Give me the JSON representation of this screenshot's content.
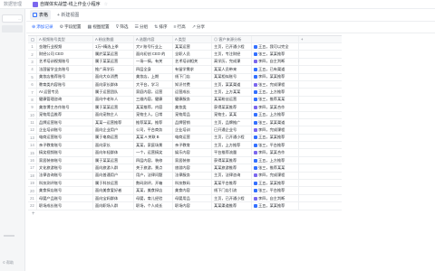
{
  "topbar": {
    "crumb": "数据管理",
    "doc_title": "自媒体实战营-线上作业小程序",
    "star": "☆"
  },
  "sidebar": {
    "active_label": "...",
    "bottom_label": "© 帮助"
  },
  "tabs": [
    {
      "label": "表格",
      "active": true
    },
    {
      "label": "+ 新建视图",
      "active": false
    }
  ],
  "toolbar": {
    "add_record": "添加记录",
    "field_config": "字段配置",
    "view_config": "视图配置",
    "filter": "筛选",
    "group": "分组",
    "sort": "排序",
    "row_height": "行高",
    "share": "分享"
  },
  "table": {
    "columns": [
      "A 视频账号类型",
      "A 粉丝数据",
      "A 选题内容",
      "A 类型",
      "◎ 客户来源分析"
    ],
    "rows": [
      {
        "c1": "金融行业视频",
        "c2": "1万+精选上季",
        "c3": "大V 账号行业上",
        "c4": "某某运营",
        "c5": "主页，已开通小程"
      },
      {
        "c1": "财经公司 CEO",
        "c2": "属於某某运营",
        "c3": "面向初创 CEO 的",
        "c4": "全职人员",
        "c5": "主页，专注财经"
      },
      {
        "c1": "艺术培训视频账号",
        "c2": "属于某某运营",
        "c3": "一场一搞，有关",
        "c4": "艺术培训相关",
        "c5": "高学历，完成课"
      },
      {
        "c1": "法国留学业务账号",
        "c2": "推广高学历",
        "c3": "四层全身",
        "c4": "有留学需求",
        "c5": "某某人员带来"
      },
      {
        "c1": "美妆店推荐账号",
        "c2": "面向大众消费",
        "c3": "美妆店，上期",
        "c4": "线下门店",
        "c5": "某某相似账号"
      },
      {
        "c1": "教育类内容账号",
        "c2": "面向家长群体",
        "c3": "大平台，学习",
        "c4": "知识付费",
        "c5": "主页，某某渠道"
      },
      {
        "c1": "AI 运营专员",
        "c2": "属于运营团队",
        "c3": "家庭内容，运营",
        "c4": "运营成长",
        "c5": "主页，上方某某"
      },
      {
        "c1": "健康管理咨询",
        "c2": "面向中老年人",
        "c3": "三维内容，健康",
        "c4": "健康服务",
        "c5": "某某粉丝运营"
      },
      {
        "c1": "美妆博主合作账号",
        "c2": "属于某某运营",
        "c3": "某某推荐，内容",
        "c4": "美妆类",
        "c5": "获得某某推荐"
      },
      {
        "c1": "宠物用品推荐",
        "c2": "面向宠物主人",
        "c3": "宠物主人，日常",
        "c4": "宠物用品",
        "c5": "宠物主，某某"
      },
      {
        "c1": "品牌运营账号",
        "c2": "某某一运营推荐",
        "c3": "推荐某某，推荐",
        "c4": "品牌营销",
        "c5": "主页，品牌推广"
      },
      {
        "c1": "企业培训账号",
        "c2": "面向企业用户",
        "c3": "公司，平台商务",
        "c4": "企业培训",
        "c5": "已开通企业号"
      },
      {
        "c1": "电商运营账号",
        "c2": "属于电商运营",
        "c3": "某某 A 关联 B",
        "c4": "电商运营",
        "c5": "主页，已开通小程"
      },
      {
        "c1": "亲子教育账号",
        "c2": "面向家长",
        "c3": "某某，家庭场景",
        "c4": "亲子教育",
        "c5": "主页，上方推荐"
      },
      {
        "c1": "搞笑视频账号",
        "c2": "面向年轻群体",
        "c3": "一个，运营搞笑",
        "c4": "娱乐内容",
        "c5": "平台推荐流量"
      },
      {
        "c1": "家居装修账号",
        "c2": "属于某某运营",
        "c3": "四层内容，装修",
        "c4": "家居装修",
        "c5": "获得某某推荐"
      },
      {
        "c1": "文化旅游账号",
        "c2": "面向旅游人群",
        "c3": "关于旅游，景点",
        "c4": "旅游内容",
        "c5": "某某旅游推荐"
      },
      {
        "c1": "法律咨询账号",
        "c2": "面向普通用户",
        "c3": "用户，法律问题",
        "c4": "法律服务",
        "c5": "主页，法律咨询"
      },
      {
        "c1": "科技测评账号",
        "c2": "属于科技运营",
        "c3": "数码测评，开箱",
        "c4": "科技数码",
        "c5": "某某平台推荐"
      },
      {
        "c1": "美食探店账号",
        "c2": "面向美食爱好者",
        "c3": "某某，美食探店",
        "c4": "美食内容",
        "c5": "线下门店引流"
      },
      {
        "c1": "母婴产品账号",
        "c2": "面向宝妈群体",
        "c3": "母婴，育儿经验",
        "c4": "母婴用品",
        "c5": "主页，已开通小程"
      },
      {
        "c1": "职场成长账号",
        "c2": "面向职场人群",
        "c3": "职场，个人成长",
        "c4": "职场内容",
        "c5": "某某渠道推荐"
      }
    ],
    "row_tags": [
      "王五",
      "张三",
      "李四",
      "王五",
      "李四",
      "张三",
      "王五",
      "张三",
      "李四",
      "王五",
      "张三",
      "李四",
      "王五",
      "张三",
      "李四",
      "王五",
      "张三",
      "李四",
      "王五",
      "张三",
      "李四",
      "王五"
    ],
    "tag_texts": [
      "王五，我可以完全",
      "张三，某某推荐",
      "李四，自主判断",
      "王五，已有渠道",
      "李四，某某推荐",
      "张三，完成课程",
      "王五，上方推荐",
      "张三，推荐某某",
      "李四，某某合作",
      "王五，上方推荐",
      "张三，某某渠道",
      "李四，完成课程",
      "王五，某某推荐",
      "张三，平台推荐",
      "李四，某某合作",
      "王五，上方推荐",
      "张三，推荐某某",
      "李四，完成课程",
      "王五，某某推荐",
      "张三，平台推荐",
      "李四，自主判断",
      "王五，某某推荐"
    ],
    "add_row_label": "+"
  }
}
